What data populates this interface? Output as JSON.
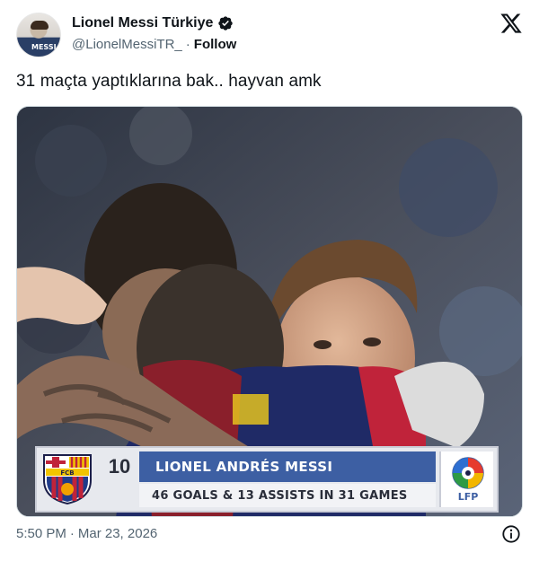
{
  "author": {
    "display_name": "Lionel Messi Türkiye",
    "handle": "@LionelMessiTR_",
    "separator": "·",
    "follow_label": "Follow",
    "avatar_shirt_text": "MESSI"
  },
  "tweet": {
    "text": "31 maçta yaptıklarına bak.. hayvan amk"
  },
  "media": {
    "banner": {
      "shirt_number": "10",
      "player_name": "LIONEL ANDRÉS MESSI",
      "stat_line": "46 GOALS & 13 ASSISTS IN 31 GAMES",
      "club_crest_letters": "FCB",
      "league_text": "LFP"
    }
  },
  "footer": {
    "time": "5:50 PM",
    "separator": "·",
    "date": "Mar 23, 2026"
  },
  "colors": {
    "verified": "#1d9bf0",
    "banner_blue": "#3d5fa3",
    "text_primary": "#0f1419",
    "text_secondary": "#536471"
  }
}
